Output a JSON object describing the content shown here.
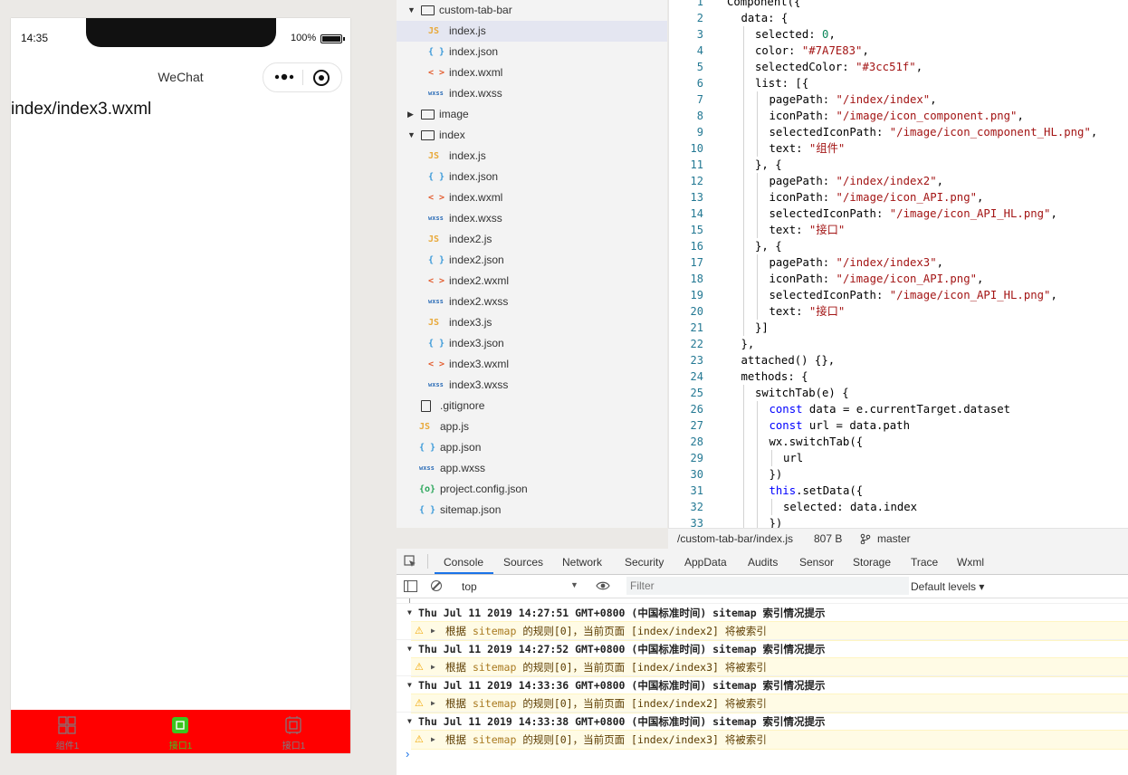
{
  "simulator": {
    "time": "14:35",
    "battery": "100%",
    "nav_title": "WeChat",
    "page_text": "index/index3.wxml",
    "tabbar": {
      "background": "#ff0000",
      "tabs": [
        {
          "label": "组件1",
          "icon": "component-icon",
          "selected": false,
          "color": "#7A7E83"
        },
        {
          "label": "接口1",
          "icon": "api-icon",
          "selected": true,
          "color": "#3cc51f"
        },
        {
          "label": "接口1",
          "icon": "api-icon",
          "selected": false,
          "color": "#7A7E83"
        }
      ]
    }
  },
  "file_tree": {
    "items": [
      {
        "name": "custom-tab-bar",
        "type": "folder",
        "expanded": true
      },
      {
        "name": "index.js",
        "type": "js",
        "active": true
      },
      {
        "name": "index.json",
        "type": "json"
      },
      {
        "name": "index.wxml",
        "type": "wxml"
      },
      {
        "name": "index.wxss",
        "type": "wxss"
      },
      {
        "name": "image",
        "type": "folder",
        "expanded": false
      },
      {
        "name": "index",
        "type": "folder",
        "expanded": true
      },
      {
        "name": "index.js",
        "type": "js"
      },
      {
        "name": "index.json",
        "type": "json"
      },
      {
        "name": "index.wxml",
        "type": "wxml"
      },
      {
        "name": "index.wxss",
        "type": "wxss"
      },
      {
        "name": "index2.js",
        "type": "js"
      },
      {
        "name": "index2.json",
        "type": "json"
      },
      {
        "name": "index2.wxml",
        "type": "wxml"
      },
      {
        "name": "index2.wxss",
        "type": "wxss"
      },
      {
        "name": "index3.js",
        "type": "js"
      },
      {
        "name": "index3.json",
        "type": "json"
      },
      {
        "name": "index3.wxml",
        "type": "wxml"
      },
      {
        "name": "index3.wxss",
        "type": "wxss"
      },
      {
        "name": ".gitignore",
        "type": "file"
      },
      {
        "name": "app.js",
        "type": "js"
      },
      {
        "name": "app.json",
        "type": "json"
      },
      {
        "name": "app.wxss",
        "type": "wxss"
      },
      {
        "name": "project.config.json",
        "type": "config"
      },
      {
        "name": "sitemap.json",
        "type": "json"
      }
    ],
    "icon_glyphs": {
      "js": "JS",
      "json": "{ }",
      "wxml": "< >",
      "wxss": "wxss",
      "config": "{o}"
    }
  },
  "editor": {
    "line_numbers": [
      "1",
      "2",
      "3",
      "4",
      "5",
      "6",
      "7",
      "8",
      "9",
      "10",
      "11",
      "12",
      "13",
      "14",
      "15",
      "16",
      "17",
      "18",
      "19",
      "20",
      "21",
      "22",
      "23",
      "24",
      "25",
      "26",
      "27",
      "28",
      "29",
      "30",
      "31",
      "32",
      "33"
    ],
    "lines": [
      {
        "indent": 0,
        "tokens": [
          [
            "p",
            "Component({"
          ]
        ]
      },
      {
        "indent": 1,
        "tokens": [
          [
            "p",
            "data: {"
          ]
        ]
      },
      {
        "indent": 2,
        "tokens": [
          [
            "p",
            "selected: "
          ],
          [
            "num",
            "0"
          ],
          [
            "p",
            ","
          ]
        ]
      },
      {
        "indent": 2,
        "tokens": [
          [
            "p",
            "color: "
          ],
          [
            "str",
            "\"#7A7E83\""
          ],
          [
            "p",
            ","
          ]
        ]
      },
      {
        "indent": 2,
        "tokens": [
          [
            "p",
            "selectedColor: "
          ],
          [
            "str",
            "\"#3cc51f\""
          ],
          [
            "p",
            ","
          ]
        ]
      },
      {
        "indent": 2,
        "tokens": [
          [
            "p",
            "list: [{"
          ]
        ]
      },
      {
        "indent": 3,
        "tokens": [
          [
            "p",
            "pagePath: "
          ],
          [
            "str",
            "\"/index/index\""
          ],
          [
            "p",
            ","
          ]
        ]
      },
      {
        "indent": 3,
        "tokens": [
          [
            "p",
            "iconPath: "
          ],
          [
            "str",
            "\"/image/icon_component.png\""
          ],
          [
            "p",
            ","
          ]
        ]
      },
      {
        "indent": 3,
        "tokens": [
          [
            "p",
            "selectedIconPath: "
          ],
          [
            "str",
            "\"/image/icon_component_HL.png\""
          ],
          [
            "p",
            ","
          ]
        ]
      },
      {
        "indent": 3,
        "tokens": [
          [
            "p",
            "text: "
          ],
          [
            "str",
            "\"组件\""
          ]
        ]
      },
      {
        "indent": 2,
        "tokens": [
          [
            "p",
            "}, {"
          ]
        ]
      },
      {
        "indent": 3,
        "tokens": [
          [
            "p",
            "pagePath: "
          ],
          [
            "str",
            "\"/index/index2\""
          ],
          [
            "p",
            ","
          ]
        ]
      },
      {
        "indent": 3,
        "tokens": [
          [
            "p",
            "iconPath: "
          ],
          [
            "str",
            "\"/image/icon_API.png\""
          ],
          [
            "p",
            ","
          ]
        ]
      },
      {
        "indent": 3,
        "tokens": [
          [
            "p",
            "selectedIconPath: "
          ],
          [
            "str",
            "\"/image/icon_API_HL.png\""
          ],
          [
            "p",
            ","
          ]
        ]
      },
      {
        "indent": 3,
        "tokens": [
          [
            "p",
            "text: "
          ],
          [
            "str",
            "\"接口\""
          ]
        ]
      },
      {
        "indent": 2,
        "tokens": [
          [
            "p",
            "}, {"
          ]
        ]
      },
      {
        "indent": 3,
        "tokens": [
          [
            "p",
            "pagePath: "
          ],
          [
            "str",
            "\"/index/index3\""
          ],
          [
            "p",
            ","
          ]
        ]
      },
      {
        "indent": 3,
        "tokens": [
          [
            "p",
            "iconPath: "
          ],
          [
            "str",
            "\"/image/icon_API.png\""
          ],
          [
            "p",
            ","
          ]
        ]
      },
      {
        "indent": 3,
        "tokens": [
          [
            "p",
            "selectedIconPath: "
          ],
          [
            "str",
            "\"/image/icon_API_HL.png\""
          ],
          [
            "p",
            ","
          ]
        ]
      },
      {
        "indent": 3,
        "tokens": [
          [
            "p",
            "text: "
          ],
          [
            "str",
            "\"接口\""
          ]
        ]
      },
      {
        "indent": 2,
        "tokens": [
          [
            "p",
            "}]"
          ]
        ]
      },
      {
        "indent": 1,
        "tokens": [
          [
            "p",
            "},"
          ]
        ]
      },
      {
        "indent": 1,
        "tokens": [
          [
            "p",
            "attached() {},"
          ]
        ]
      },
      {
        "indent": 1,
        "tokens": [
          [
            "p",
            "methods: {"
          ]
        ]
      },
      {
        "indent": 2,
        "tokens": [
          [
            "p",
            "switchTab(e) {"
          ]
        ]
      },
      {
        "indent": 3,
        "tokens": [
          [
            "kw",
            "const"
          ],
          [
            "p",
            " data = e.currentTarget.dataset"
          ]
        ]
      },
      {
        "indent": 3,
        "tokens": [
          [
            "kw",
            "const"
          ],
          [
            "p",
            " url = data.path"
          ]
        ]
      },
      {
        "indent": 3,
        "tokens": [
          [
            "p",
            "wx.switchTab({"
          ]
        ]
      },
      {
        "indent": 4,
        "tokens": [
          [
            "p",
            "url"
          ]
        ]
      },
      {
        "indent": 3,
        "tokens": [
          [
            "p",
            "})"
          ]
        ]
      },
      {
        "indent": 3,
        "tokens": [
          [
            "kw",
            "this"
          ],
          [
            "p",
            ".setData({"
          ]
        ]
      },
      {
        "indent": 4,
        "tokens": [
          [
            "p",
            "selected: data.index"
          ]
        ]
      },
      {
        "indent": 3,
        "tokens": [
          [
            "p",
            "})"
          ]
        ]
      }
    ]
  },
  "status_bar": {
    "path": "/custom-tab-bar/index.js",
    "size": "807 B",
    "branch": "master"
  },
  "devtools": {
    "tabs": [
      "Console",
      "Sources",
      "Network",
      "Security",
      "AppData",
      "Audits",
      "Sensor",
      "Storage",
      "Trace",
      "Wxml"
    ],
    "active_tab": "Console",
    "context": "top",
    "filter_placeholder": "Filter",
    "levels": "Default levels ▾",
    "logs": [
      {
        "head": "Thu Jul 11 2019 14:27:51 GMT+0800 (中国标准时间) sitemap 索引情况提示",
        "warn_pre": "根据 ",
        "warn_hl": "sitemap",
        "warn_post": " 的规则[0]，当前页面 [index/index2] 将被索引"
      },
      {
        "head": "Thu Jul 11 2019 14:27:52 GMT+0800 (中国标准时间) sitemap 索引情况提示",
        "warn_pre": "根据 ",
        "warn_hl": "sitemap",
        "warn_post": " 的规则[0]，当前页面 [index/index3] 将被索引"
      },
      {
        "head": "Thu Jul 11 2019 14:33:36 GMT+0800 (中国标准时间) sitemap 索引情况提示",
        "warn_pre": "根据 ",
        "warn_hl": "sitemap",
        "warn_post": " 的规则[0]，当前页面 [index/index2] 将被索引"
      },
      {
        "head": "Thu Jul 11 2019 14:33:38 GMT+0800 (中国标准时间) sitemap 索引情况提示",
        "warn_pre": "根据 ",
        "warn_hl": "sitemap",
        "warn_post": " 的规则[0]，当前页面 [index/index3] 将被索引"
      }
    ],
    "prompt": "›"
  },
  "colors": {
    "js": "#e8a93a",
    "json": "#3b9ad9",
    "wxml": "#e35d2f",
    "wxss": "#2f6fb8",
    "config": "#2aa65a",
    "tab_selected": "#3cc51f",
    "tab_normal": "#7A7E83"
  }
}
